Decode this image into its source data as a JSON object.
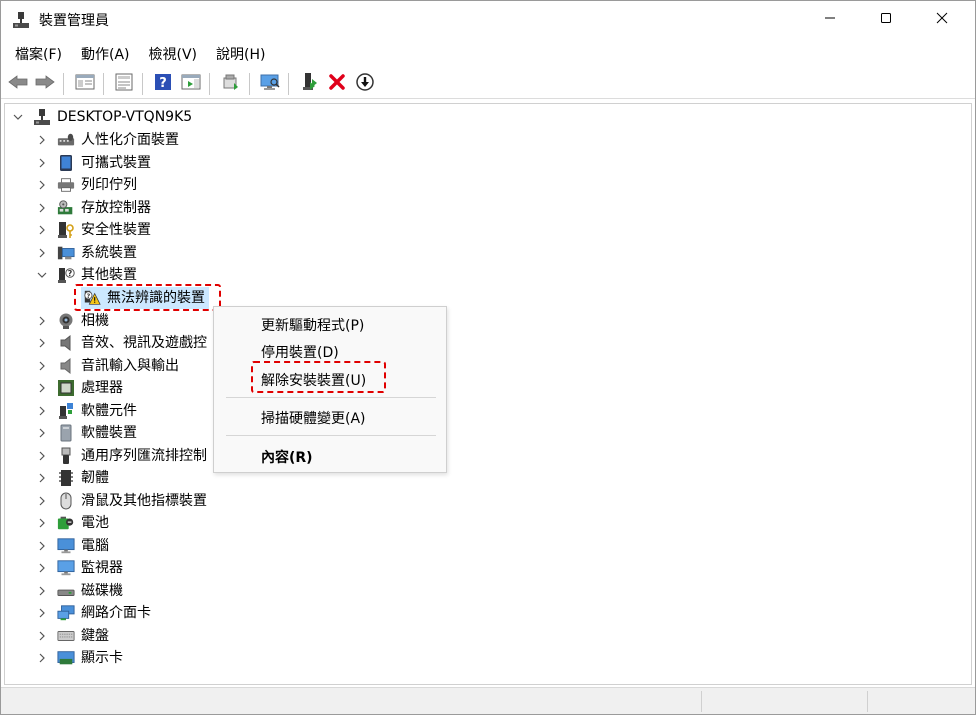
{
  "window": {
    "title": "裝置管理員",
    "controls": [
      "minimize-icon",
      "maximize-icon",
      "close-icon"
    ]
  },
  "menubar": {
    "items": [
      "檔案(F)",
      "動作(A)",
      "檢視(V)",
      "說明(H)"
    ]
  },
  "toolbar": {
    "buttons": [
      "back-arrow-icon",
      "forward-arrow-icon",
      "show-hide-console-tree-icon",
      "properties-icon",
      "help-icon",
      "action-pane-icon",
      "update-driver-icon",
      "monitor-scan-icon",
      "enable-device-icon",
      "uninstall-x-icon",
      "disable-device-icon"
    ],
    "accent_red": "#e0001a",
    "accent_green": "#2e9e3a"
  },
  "tree": {
    "root": "DESKTOP-VTQN9K5",
    "categories": [
      {
        "label": "人性化介面裝置",
        "icon": "hid-icon"
      },
      {
        "label": "可攜式裝置",
        "icon": "portable-device-icon"
      },
      {
        "label": "列印佇列",
        "icon": "printer-icon"
      },
      {
        "label": "存放控制器",
        "icon": "storage-controller-icon"
      },
      {
        "label": "安全性裝置",
        "icon": "security-device-icon"
      },
      {
        "label": "系統裝置",
        "icon": "system-device-icon"
      },
      {
        "label": "其他裝置",
        "icon": "other-device-icon",
        "expanded": true
      },
      {
        "label": "相機",
        "icon": "camera-icon"
      },
      {
        "label": "音效、視訊及遊戲控",
        "icon": "speaker-icon"
      },
      {
        "label": "音訊輸入與輸出",
        "icon": "audio-io-icon"
      },
      {
        "label": "處理器",
        "icon": "processor-icon"
      },
      {
        "label": "軟體元件",
        "icon": "software-component-icon"
      },
      {
        "label": "軟體裝置",
        "icon": "software-device-icon"
      },
      {
        "label": "通用序列匯流排控制",
        "icon": "usb-icon"
      },
      {
        "label": "韌體",
        "icon": "firmware-icon"
      },
      {
        "label": "滑鼠及其他指標裝置",
        "icon": "mouse-icon"
      },
      {
        "label": "電池",
        "icon": "battery-icon"
      },
      {
        "label": "電腦",
        "icon": "computer-icon"
      },
      {
        "label": "監視器",
        "icon": "monitor-icon"
      },
      {
        "label": "磁碟機",
        "icon": "disk-drive-icon"
      },
      {
        "label": "網路介面卡",
        "icon": "network-adapter-icon"
      },
      {
        "label": "鍵盤",
        "icon": "keyboard-icon"
      },
      {
        "label": "顯示卡",
        "icon": "display-adapter-icon"
      }
    ],
    "selected_child": "無法辨識的裝置",
    "selection_color": "#cce8ff",
    "highlight_color": "#e00000"
  },
  "context_menu": {
    "items": [
      {
        "label": "更新驅動程式(P)"
      },
      {
        "label": "停用裝置(D)"
      },
      {
        "label": "解除安裝裝置(U)",
        "highlighted": true
      },
      {
        "label": "掃描硬體變更(A)"
      },
      {
        "label": "內容(R)",
        "bold": true
      }
    ]
  }
}
